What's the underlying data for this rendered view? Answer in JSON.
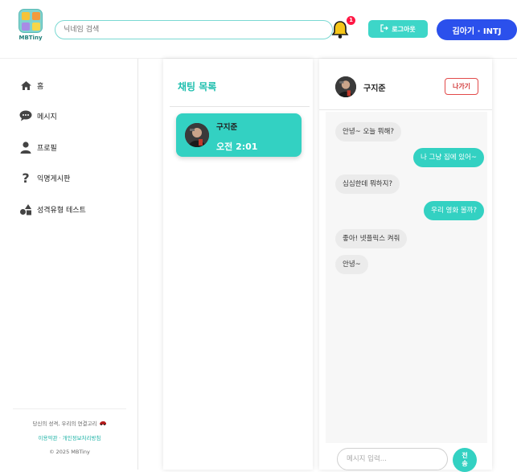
{
  "header": {
    "logo_text": "MBTiny",
    "search_placeholder": "닉네임 검색",
    "notification_count": "1",
    "logout_label": "로그아웃",
    "user_label": "김아기 · INTJ"
  },
  "sidebar": {
    "items": [
      {
        "label": "홈",
        "icon": "home-icon"
      },
      {
        "label": "메시지",
        "icon": "chat-bubble-icon"
      },
      {
        "label": "프로필",
        "icon": "user-icon"
      },
      {
        "label": "익명게시판",
        "icon": "question-icon"
      },
      {
        "label": "성격유형 테스트",
        "icon": "shapes-icon"
      }
    ],
    "footer": {
      "slogan": "당신의 성격, 우리의 연결고리",
      "links": "이용약관 · 개인정보처리방침",
      "copyright": "© 2025 MBTiny"
    }
  },
  "chat_list": {
    "title": "채팅 목록",
    "items": [
      {
        "name": "구지준",
        "time": "오전 2:01"
      }
    ]
  },
  "chat_room": {
    "partner_name": "구지준",
    "leave_label": "나가기",
    "messages": [
      {
        "side": "in",
        "text": "안녕~ 오늘 뭐해?"
      },
      {
        "side": "out",
        "text": "나 그냥 집에 있어~"
      },
      {
        "side": "in",
        "text": "심심한데 뭐하지?"
      },
      {
        "side": "out",
        "text": "우리 영화 볼까?"
      },
      {
        "side": "in",
        "text": "좋아! 넷플릭스 켜줘"
      },
      {
        "side": "in",
        "text": "안녕~"
      }
    ],
    "input_placeholder": "메시지 입력...",
    "send_label": "전송"
  },
  "colors": {
    "accent": "#33d1c2",
    "primary": "#2b50ec",
    "danger": "#e24a4a"
  }
}
